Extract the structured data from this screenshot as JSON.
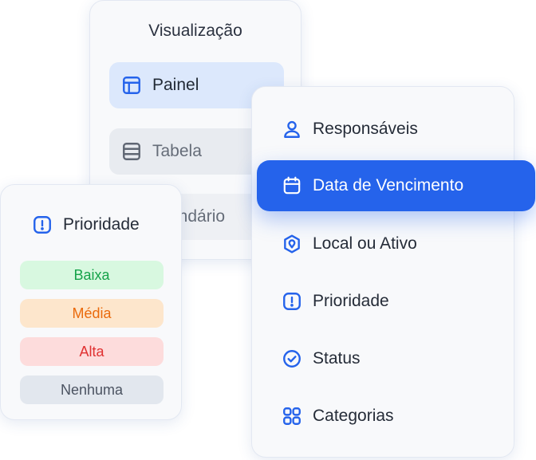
{
  "view_panel": {
    "title": "Visualização",
    "items": [
      {
        "label": "Painel",
        "icon": "layout-icon",
        "state": "selected"
      },
      {
        "label": "Tabela",
        "icon": "table-icon",
        "state": "default"
      },
      {
        "label": "endário",
        "icon": "calendar-icon",
        "state": "default"
      }
    ]
  },
  "group_menu": {
    "items": [
      {
        "label": "Responsáveis",
        "icon": "user-icon"
      },
      {
        "label": "Data de Vencimento",
        "icon": "calendar-icon",
        "active": true
      },
      {
        "label": "Local ou Ativo",
        "icon": "location-asset-icon"
      },
      {
        "label": "Prioridade",
        "icon": "alert-square-icon"
      },
      {
        "label": "Status",
        "icon": "check-circle-icon"
      },
      {
        "label": "Categorias",
        "icon": "categories-icon"
      }
    ]
  },
  "priority_panel": {
    "title": "Prioridade",
    "levels": [
      {
        "label": "Baixa",
        "color": "#16a34a"
      },
      {
        "label": "Média",
        "color": "#ea6a0c"
      },
      {
        "label": "Alta",
        "color": "#e03131"
      },
      {
        "label": "Nenhuma",
        "color": "#4b5361"
      }
    ]
  },
  "colors": {
    "accent": "#2563eb",
    "icon": "#2563eb"
  }
}
